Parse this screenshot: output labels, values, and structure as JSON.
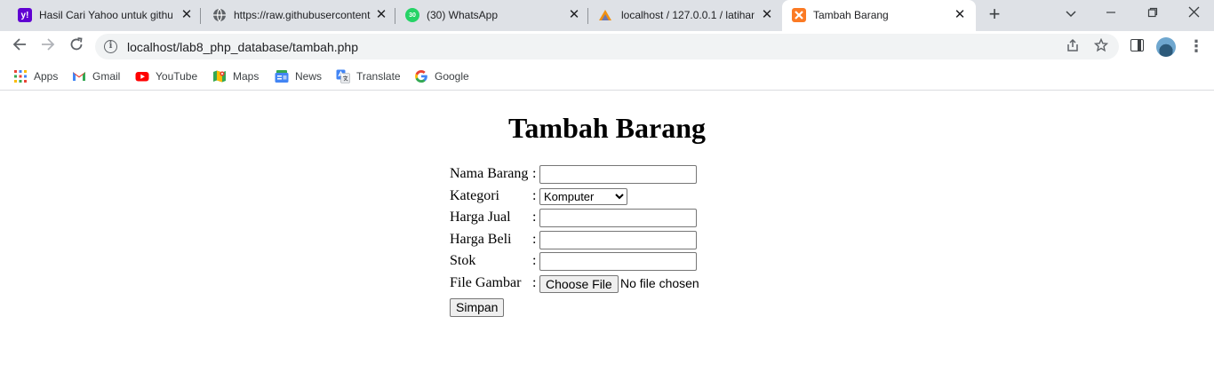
{
  "browser": {
    "tabs": [
      {
        "title": "Hasil Cari Yahoo untuk github",
        "icon": "yahoo-icon",
        "color": "#6001d2",
        "badge": "y!"
      },
      {
        "title": "https://raw.githubusercontent",
        "icon": "globe-icon",
        "color": "#5f6368",
        "badge": ""
      },
      {
        "title": "(30) WhatsApp",
        "icon": "whatsapp-icon",
        "color": "#25d366",
        "badge": "30"
      },
      {
        "title": "localhost / 127.0.0.1 / latihan",
        "icon": "phpmyadmin-icon",
        "color": "#f29111",
        "badge": ""
      },
      {
        "title": "Tambah Barang",
        "icon": "xampp-icon",
        "color": "#fb7a24",
        "badge": "",
        "active": true
      }
    ],
    "address_bar": {
      "url": "localhost/lab8_php_database/tambah.php"
    },
    "bookmarks": [
      {
        "label": "Apps",
        "icon": "apps-grid-icon"
      },
      {
        "label": "Gmail",
        "icon": "gmail-icon"
      },
      {
        "label": "YouTube",
        "icon": "youtube-icon"
      },
      {
        "label": "Maps",
        "icon": "maps-icon"
      },
      {
        "label": "News",
        "icon": "news-icon"
      },
      {
        "label": "Translate",
        "icon": "translate-icon"
      },
      {
        "label": "Google",
        "icon": "google-icon"
      }
    ]
  },
  "page": {
    "title": "Tambah Barang",
    "form": {
      "nama_barang": {
        "label": "Nama Barang",
        "colon": ":",
        "value": ""
      },
      "kategori": {
        "label": "Kategori",
        "colon": ":",
        "selected": "Komputer"
      },
      "harga_jual": {
        "label": "Harga Jual",
        "colon": ":",
        "value": ""
      },
      "harga_beli": {
        "label": "Harga Beli",
        "colon": ":",
        "value": ""
      },
      "stok": {
        "label": "Stok",
        "colon": ":",
        "value": ""
      },
      "file_gambar": {
        "label": "File Gambar",
        "colon": ":",
        "button": "Choose File",
        "status": "No file chosen"
      },
      "submit_label": "Simpan"
    }
  }
}
